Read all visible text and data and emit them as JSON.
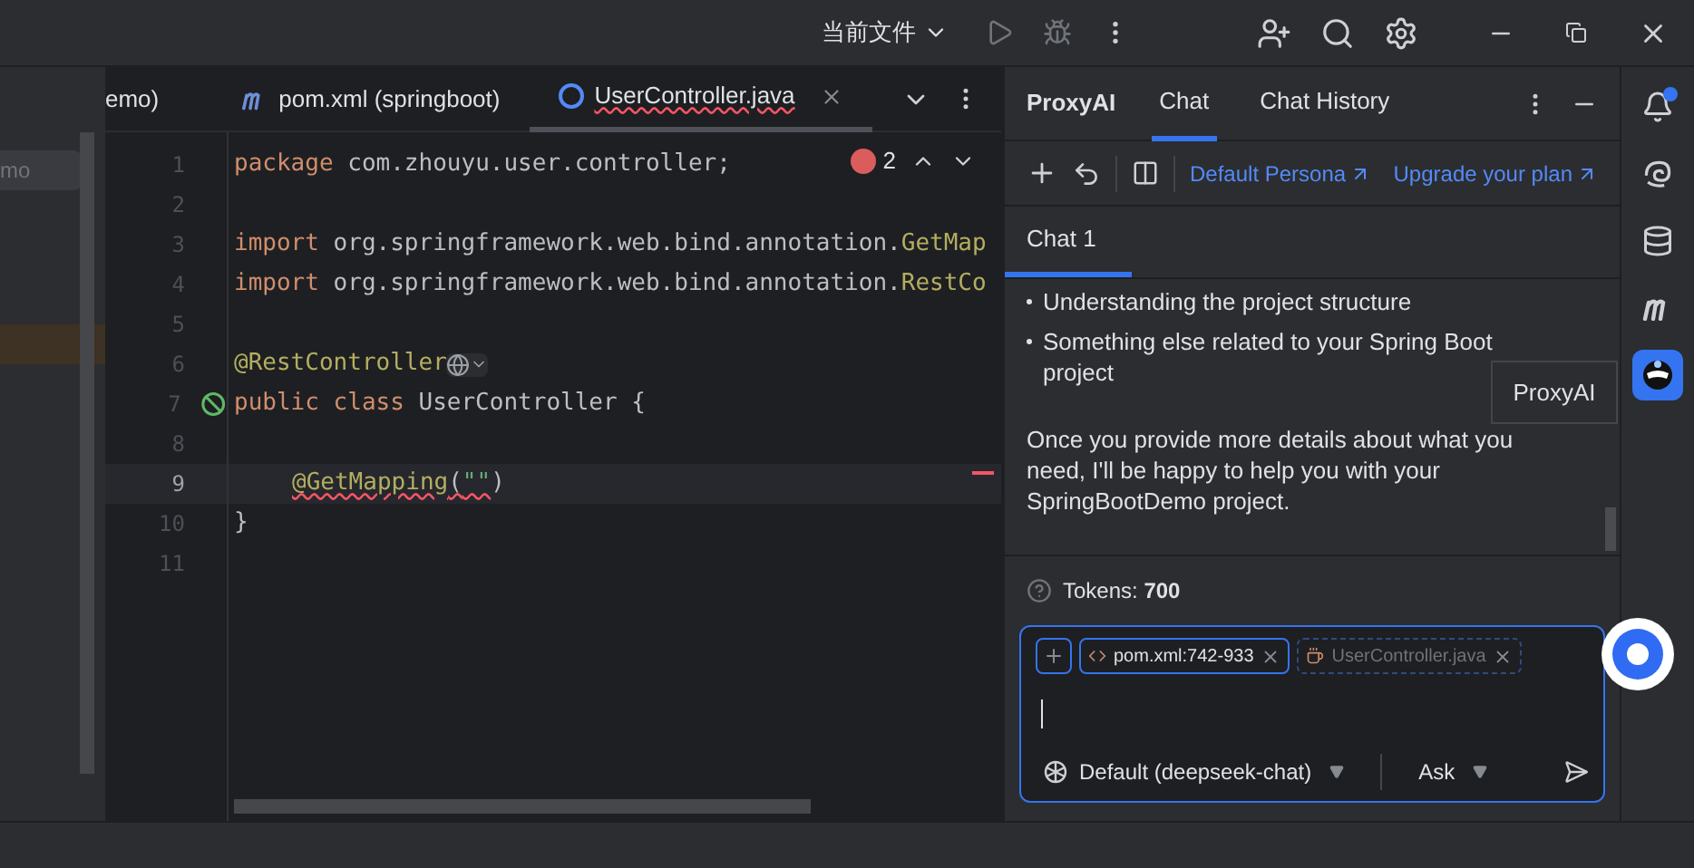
{
  "top_bar": {
    "run_config": "当前文件"
  },
  "project_pane": {
    "field_text": "mo"
  },
  "editor_tabs": [
    {
      "label": "emo)",
      "kind": "partial",
      "selected": false,
      "closable": false
    },
    {
      "label": "pom.xml (springboot)",
      "kind": "maven",
      "selected": false,
      "closable": false
    },
    {
      "label": "UserController.java",
      "kind": "class",
      "selected": true,
      "closable": true
    }
  ],
  "problems": {
    "errors": "2"
  },
  "code_lines": [
    {
      "number": "1",
      "current": false,
      "marker": false,
      "tokens": [
        {
          "kind": "keyword",
          "text": "package"
        },
        {
          "kind": "plain",
          "text": " com.zhouyu.user.controller;"
        }
      ]
    },
    {
      "number": "2",
      "current": false,
      "marker": false
    },
    {
      "number": "3",
      "current": false,
      "marker": false,
      "tokens": [
        {
          "kind": "keyword",
          "text": "import"
        },
        {
          "kind": "plain",
          "text": " org.springframework.web.bind.annotation."
        },
        {
          "kind": "annotation",
          "text": "GetMap"
        }
      ]
    },
    {
      "number": "4",
      "current": false,
      "marker": false,
      "tokens": [
        {
          "kind": "keyword",
          "text": "import"
        },
        {
          "kind": "plain",
          "text": " org.springframework.web.bind.annotation."
        },
        {
          "kind": "annotation",
          "text": "RestCo"
        }
      ]
    },
    {
      "number": "5",
      "current": false,
      "marker": false
    },
    {
      "number": "6",
      "current": false,
      "marker": false,
      "tokens": [
        {
          "kind": "annotation",
          "text": "@RestController"
        },
        {
          "kind": "globe"
        }
      ]
    },
    {
      "number": "7",
      "current": false,
      "marker": true,
      "tokens": [
        {
          "kind": "keyword",
          "text": "public class"
        },
        {
          "kind": "plain",
          "text": " UserController {"
        }
      ]
    },
    {
      "number": "8",
      "current": false,
      "marker": false
    },
    {
      "number": "9",
      "current": true,
      "marker": false,
      "tokens": [
        {
          "kind": "indent"
        },
        {
          "kind": "annotation_error",
          "text": "@GetMapping"
        },
        {
          "kind": "plain_error",
          "text": "("
        },
        {
          "kind": "string_error",
          "text": "\"\""
        },
        {
          "kind": "plain",
          "text": ")"
        }
      ]
    },
    {
      "number": "10",
      "current": false,
      "marker": false,
      "tokens": [
        {
          "kind": "plain",
          "text": "}"
        }
      ]
    },
    {
      "number": "11",
      "current": false,
      "marker": false
    }
  ],
  "chat_panel": {
    "title": "ProxyAI",
    "tabs": [
      {
        "label": "Chat",
        "selected": true
      },
      {
        "label": "Chat History",
        "selected": false
      }
    ],
    "links": [
      "Default Persona",
      "Upgrade your plan"
    ],
    "chat_tabs": [
      {
        "label": "Chat 1",
        "selected": true
      }
    ],
    "bullets": [
      "Understanding the project structure",
      "Something else related to your Spring Boot project"
    ],
    "paragraph": "Once you provide more details about what you need, I'll be happy to help you with your SpringBootDemo project.",
    "tooltip": "ProxyAI",
    "tokens": {
      "label": "Tokens:",
      "value": "700"
    },
    "chips": [
      {
        "label": "pom.xml:742-933",
        "kind": "code",
        "included": true
      },
      {
        "label": "UserController.java",
        "kind": "java",
        "included": false
      }
    ],
    "model": "Default (deepseek-chat)",
    "mode": "Ask"
  },
  "tool_strip": [
    {
      "kind": "bell",
      "selected": false
    },
    {
      "kind": "swirl",
      "selected": false
    },
    {
      "kind": "database",
      "selected": false
    },
    {
      "kind": "maven",
      "selected": false
    },
    {
      "kind": "proxyai",
      "selected": true
    }
  ]
}
